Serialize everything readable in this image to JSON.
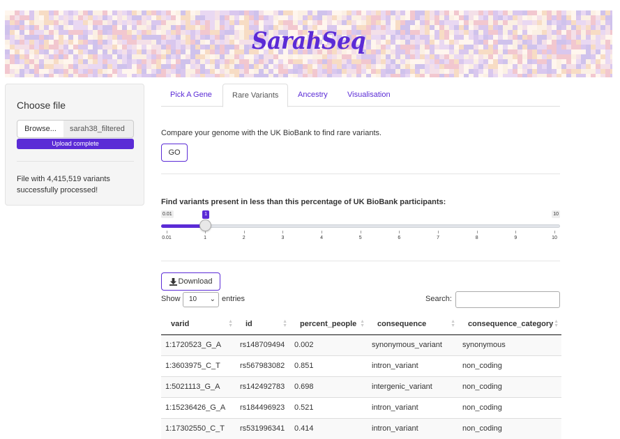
{
  "banner": {
    "title": "SarahSeq"
  },
  "sidebar": {
    "heading": "Choose file",
    "browse_label": "Browse...",
    "file_name": "sarah38_filtered",
    "upload_status": "Upload complete",
    "status_text": "File with 4,415,519 variants successfully processed!"
  },
  "tabs": [
    {
      "label": "Pick A Gene",
      "active": false
    },
    {
      "label": "Rare Variants",
      "active": true
    },
    {
      "label": "Ancestry",
      "active": false
    },
    {
      "label": "Visualisation",
      "active": false
    }
  ],
  "main": {
    "intro": "Compare your genome with the UK BioBank to find rare variants.",
    "go_label": "GO",
    "slider": {
      "label": "Find variants present in less than this percentage of UK BioBank participants:",
      "min_label": "0.01",
      "max_label": "10",
      "value_label": "1",
      "value": 1,
      "min": 0.01,
      "max": 10,
      "ticks": [
        "0.01",
        "1",
        "2",
        "3",
        "4",
        "5",
        "6",
        "7",
        "8",
        "9",
        "10"
      ]
    },
    "download_label": "Download",
    "show_label": "Show",
    "entries_value": "10",
    "entries_label": "entries",
    "search_label": "Search:",
    "search_value": ""
  },
  "table": {
    "headers": [
      "varid",
      "id",
      "percent_people",
      "consequence",
      "consequence_category"
    ],
    "rows": [
      [
        "1:1720523_G_A",
        "rs148709494",
        "0.002",
        "synonymous_variant",
        "synonymous"
      ],
      [
        "1:3603975_C_T",
        "rs567983082",
        "0.851",
        "intron_variant",
        "non_coding"
      ],
      [
        "1:5021113_G_A",
        "rs142492783",
        "0.698",
        "intergenic_variant",
        "non_coding"
      ],
      [
        "1:15236426_G_A",
        "rs184496923",
        "0.521",
        "intron_variant",
        "non_coding"
      ],
      [
        "1:17302550_C_T",
        "rs531996341",
        "0.414",
        "intron_variant",
        "non_coding"
      ]
    ]
  },
  "colors": {
    "accent": "#5b2bd6",
    "link": "#337ab7"
  },
  "icons": {
    "download": "download-icon",
    "sort": "sort-icon",
    "chevron": "chevron-down-icon"
  }
}
